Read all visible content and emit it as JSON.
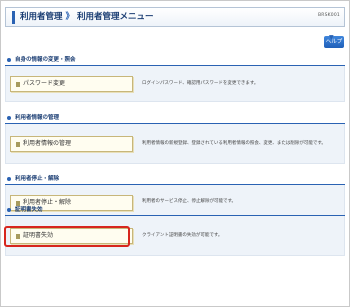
{
  "header": {
    "title_parent": "利用者管理",
    "separator": "》",
    "title_current": "利用者管理メニュー",
    "screen_code": "BRSK001"
  },
  "help": {
    "label": "ヘルプ"
  },
  "sections": [
    {
      "title": "自身の情報の変更・照会",
      "button_label": "パスワード変更",
      "description": "ログインパスワード、確認用パスワードを変更できます。"
    },
    {
      "title": "利用者情報の管理",
      "button_label": "利用者情報の管理",
      "description": "利用者情報の新規登録、登録されている利用者情報の照会、変更、または削除が可能です。"
    },
    {
      "title": "利用者停止・解除",
      "button_label": "利用者停止・解除",
      "description": "利用者のサービス停止、停止解除が可能です。"
    },
    {
      "title": "証明書失効",
      "button_label": "証明書失効",
      "description": "クライアント証明書の失効が可能です。"
    }
  ],
  "colors": {
    "accent": "#2a62b3",
    "section_bg": "#eef3f9",
    "highlight": "#d7261e"
  }
}
